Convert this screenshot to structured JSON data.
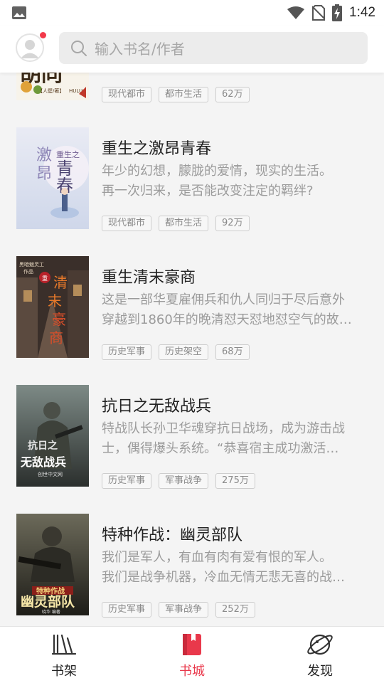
{
  "status_bar": {
    "time": "1:42"
  },
  "header": {
    "search_placeholder": "输入书名/作者"
  },
  "books": [
    {
      "title": "",
      "desc_line1": "",
      "desc_line2": "",
      "tags": [
        "现代都市",
        "都市生活",
        "62万"
      ]
    },
    {
      "title": "重生之激昂青春",
      "desc_line1": "年少的幻想，朦胧的爱情，现实的生活。",
      "desc_line2": "再一次归来，是否能改变注定的羁绊?",
      "tags": [
        "现代都市",
        "都市生活",
        "92万"
      ]
    },
    {
      "title": "重生清末豪商",
      "desc_line1": "这是一部华夏雇佣兵和仇人同归于尽后意外",
      "desc_line2": "穿越到1860年的晚清怼天怼地怼空气的故…",
      "tags": [
        "历史军事",
        "历史架空",
        "68万"
      ]
    },
    {
      "title": "抗日之无敌战兵",
      "desc_line1": "特战队长孙卫华魂穿抗日战场，成为游击战",
      "desc_line2": "士，偶得爆头系统。“恭喜宿主成功激活…",
      "tags": [
        "历史军事",
        "军事战争",
        "275万"
      ]
    },
    {
      "title": "特种作战：幽灵部队",
      "desc_line1": "我们是军人，有血有肉有爱有恨的军人。",
      "desc_line2": "我们是战争机器，冷血无情无悲无喜的战…",
      "tags": [
        "历史军事",
        "军事战争",
        "252万"
      ]
    }
  ],
  "tabbar": {
    "items": [
      {
        "label": "书架",
        "icon": "bookshelf-icon"
      },
      {
        "label": "书城",
        "icon": "bookstore-icon"
      },
      {
        "label": "发现",
        "icon": "planet-icon"
      }
    ],
    "active": "书城",
    "accent": "#e9384b"
  }
}
